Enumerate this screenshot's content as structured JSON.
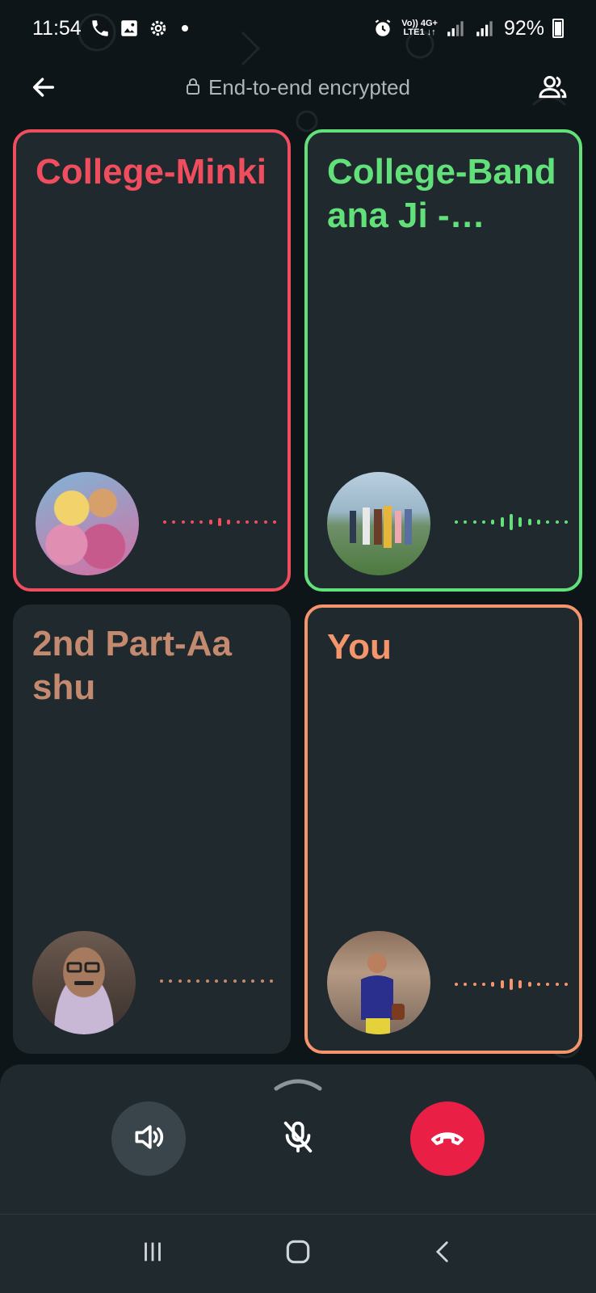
{
  "status_bar": {
    "time": "11:54",
    "net_top": "Vo)) 4G+",
    "net_bottom": "LTE1 ↓↑",
    "battery": "92%"
  },
  "header": {
    "encryption_label": "End-to-end encrypted"
  },
  "participants": [
    {
      "name": "College-Minki",
      "color": "#f04e5e",
      "border": true,
      "wave": "speaking-low"
    },
    {
      "name": "College-Bandana Ji -…",
      "color": "#62e07a",
      "border": true,
      "wave": "speaking"
    },
    {
      "name": "2nd Part-Aashu",
      "color": "#c48a6f",
      "border": false,
      "wave": "silent"
    },
    {
      "name": "You",
      "color": "#f4956c",
      "border": true,
      "wave": "speaking"
    }
  ],
  "controls": {
    "speaker_bg": "#3a454b",
    "end_call_bg": "#ea1f46"
  },
  "icons": [
    "back-arrow-icon",
    "lock-icon",
    "participants-icon",
    "speaker-icon",
    "mic-off-icon",
    "end-call-icon",
    "recents-icon",
    "home-icon",
    "back-icon"
  ]
}
